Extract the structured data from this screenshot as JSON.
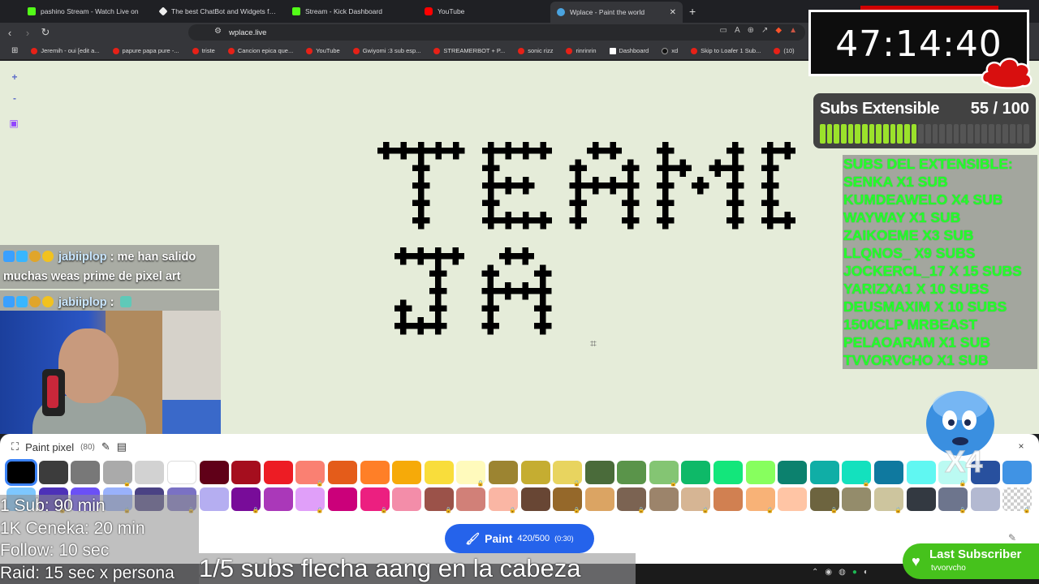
{
  "tabs": [
    {
      "title": "pashino Stream - Watch Live on",
      "color": "#53fc18"
    },
    {
      "title": "The best ChatBot and Widgets for Ki",
      "color": "#ffffff"
    },
    {
      "title": "Stream - Kick Dashboard",
      "color": "#53fc18"
    },
    {
      "title": "YouTube",
      "color": "#ff0000"
    },
    {
      "title": "Wplace - Paint the world",
      "color": "#4aa3df"
    }
  ],
  "url": "wplace.live",
  "bookmarks": [
    "Jeremih - oui [edit a...",
    "papure papa pure -...",
    "triste",
    "Cancion epica que...",
    "YouTube",
    "Gwiyomi :3 sub esp...",
    "STREAMERBOT + P...",
    "sonic rizz",
    "rinrinrin",
    "Dashboard",
    "xd",
    "Skip to Loafer 1 Sub...",
    "(10)"
  ],
  "canvas": {
    "zoom_in": "+",
    "zoom_out": "-"
  },
  "chat": [
    {
      "user": "jabiiplop",
      "message": "me han salido muchas weas prime de pixel art"
    },
    {
      "user": "jabiiplop",
      "message": ""
    }
  ],
  "timer": "47:14:40",
  "subs": {
    "title": "Subs Extensible",
    "count": "55 / 100",
    "progress": 0.55,
    "list_header": "SUBS DEL EXTENSIBLE:",
    "list": [
      "SENKA X1 SUB",
      "KUMDEAWELO X4 SUB",
      "WAYWAY X1 SUB",
      "ZAIKOEME X3 SUB",
      "LLQNOS_ X9 SUBS",
      "JOCKERCL_17 X 15 SUBS",
      "YARIZXA1 X 10 SUBS",
      "DEUSMAXIM X 10 SUBS",
      "1500CLP MRBEAST",
      "PELAOARAM X1 SUB",
      "TVVORVCHO X1 SUB"
    ]
  },
  "mascot_label": "X4",
  "panel": {
    "title": "Paint pixel",
    "count": "(80)",
    "close": "×",
    "paint_label": "Paint",
    "charges": "420/500",
    "cooldown": "(0:30)"
  },
  "palette_top": [
    "#000000",
    "#3c3c3c",
    "#787878",
    "#aaaaaa",
    "#d2d2d2",
    "#ffffff",
    "#600018",
    "#a50e1e",
    "#ed1c24",
    "#fa8072",
    "#e45c1a",
    "#ff7f27",
    "#f6aa09",
    "#f9dd3b",
    "#fffabc",
    "#9c8431",
    "#c5ad31",
    "#e8d45f",
    "#4a6b3a",
    "#5a944a",
    "#84c573",
    "#0eb968",
    "#13e67b",
    "#87ff5e",
    "#0c816e",
    "#10aea6",
    "#13e1be",
    "#0f799f",
    "#60f7f2",
    "#bbfaf2",
    "#28509e",
    "#4093e4"
  ],
  "palette_bottom": [
    "#7dc7ff",
    "#4d31b8",
    "#6b50f6",
    "#99b1fb",
    "#4a4284",
    "#7a71c4",
    "#b5aef1",
    "#780c99",
    "#aa38b9",
    "#e09ff9",
    "#cb007a",
    "#ec1f80",
    "#f38da9",
    "#9b5249",
    "#d18078",
    "#fab6a4",
    "#684634",
    "#95682a",
    "#dba463",
    "#7b6352",
    "#9c846b",
    "#d6b594",
    "#d18051",
    "#f8b277",
    "#ffc5a5",
    "#6d643f",
    "#948c6b",
    "#cdc59e",
    "#333941",
    "#6d758d",
    "#b3b9d1",
    "transparent"
  ],
  "rules": [
    "1 Sub: 90 min",
    "1K Ceneka: 20 min",
    "Follow: 10 sec",
    "Raid: 15 sec x persona"
  ],
  "ticker": "1/5 subs flecha aang en la cabeza",
  "last_sub": {
    "label": "Last Subscriber",
    "name": "tvvorvcho"
  },
  "pixel_text": [
    "TE AMO",
    "JA"
  ]
}
